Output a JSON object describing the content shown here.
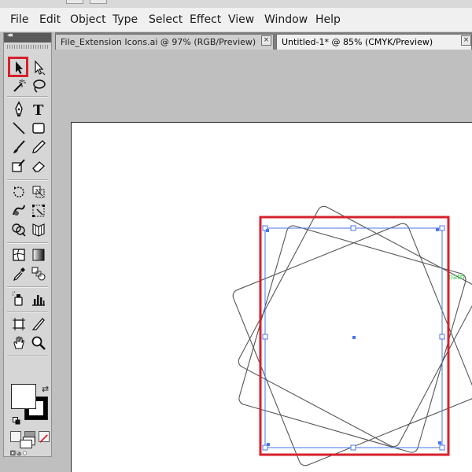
{
  "menu": {
    "items": [
      "File",
      "Edit",
      "Object",
      "Type",
      "Select",
      "Effect",
      "View",
      "Window",
      "Help"
    ]
  },
  "tabs": [
    {
      "label": "File_Extension Icons.ai @ 97% (RGB/Preview)",
      "active": false,
      "close": "×"
    },
    {
      "label": "Untitled-1* @ 85% (CMYK/Preview)",
      "active": true,
      "close": "×"
    }
  ],
  "toolbox": {
    "collapse_glyph": "◂◂",
    "selected_tool": "selection-tool",
    "fill_color": "#ffffff",
    "stroke_color": "#000000"
  },
  "canvas": {
    "smart_guide_text": "path"
  },
  "colors": {
    "highlight": "#d6202c",
    "selection": "#4a76e8",
    "smart_guide": "#3fd64f",
    "shape_stroke": "#555555"
  }
}
